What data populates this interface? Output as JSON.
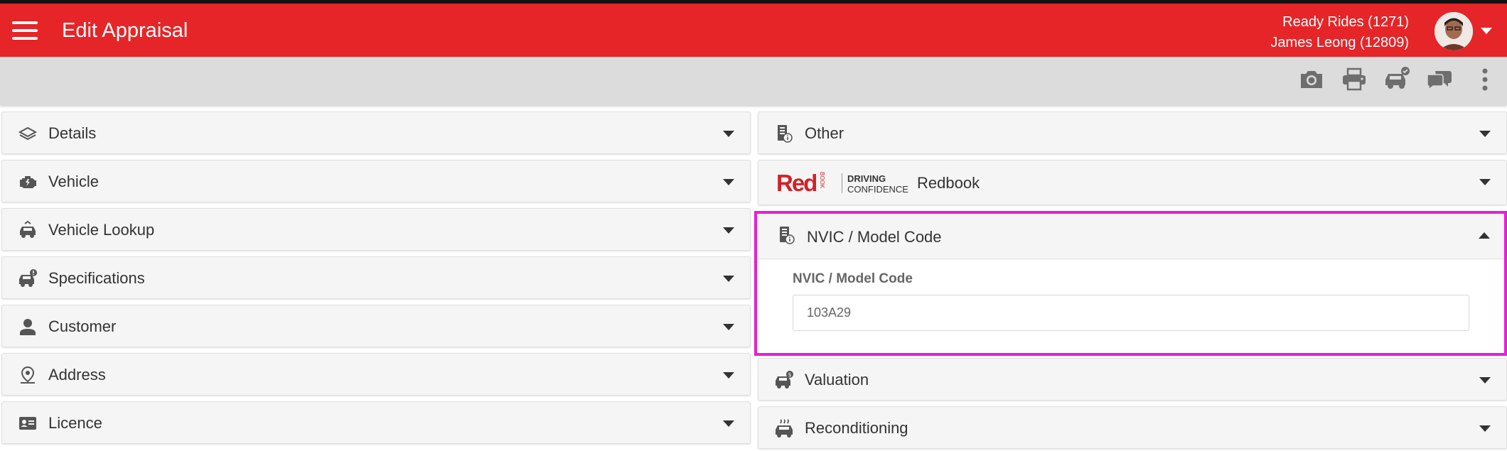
{
  "header": {
    "title": "Edit Appraisal",
    "dealer": "Ready Rides (1271)",
    "user": "James Leong (12809)"
  },
  "toolbar": {
    "icons": [
      "camera-icon",
      "print-icon",
      "vehicle-check-icon",
      "chat-icon",
      "more-vert-icon"
    ]
  },
  "left_panels": [
    {
      "label": "Details",
      "icon": "layers-icon"
    },
    {
      "label": "Vehicle",
      "icon": "engine-icon"
    },
    {
      "label": "Vehicle Lookup",
      "icon": "car-search-icon"
    },
    {
      "label": "Specifications",
      "icon": "car-info-icon"
    },
    {
      "label": "Customer",
      "icon": "person-icon"
    },
    {
      "label": "Address",
      "icon": "location-icon"
    },
    {
      "label": "Licence",
      "icon": "id-card-icon"
    }
  ],
  "right_panels": {
    "other": {
      "label": "Other",
      "icon": "info-doc-icon"
    },
    "redbook": {
      "label": "Redbook",
      "logo_red": "Red",
      "logo_book": "BOOK",
      "logo_line1": "DRIVING",
      "logo_line2": "CONFIDENCE"
    },
    "nvic": {
      "label": "NVIC / Model Code",
      "icon": "info-doc-icon",
      "field_label": "NVIC / Model Code",
      "field_value": "103A29"
    },
    "valuation": {
      "label": "Valuation",
      "icon": "car-dollar-icon"
    },
    "reconditioning": {
      "label": "Reconditioning",
      "icon": "car-wash-icon"
    }
  },
  "colors": {
    "brand_red": "#e52528",
    "highlight_magenta": "#e61fd6"
  }
}
